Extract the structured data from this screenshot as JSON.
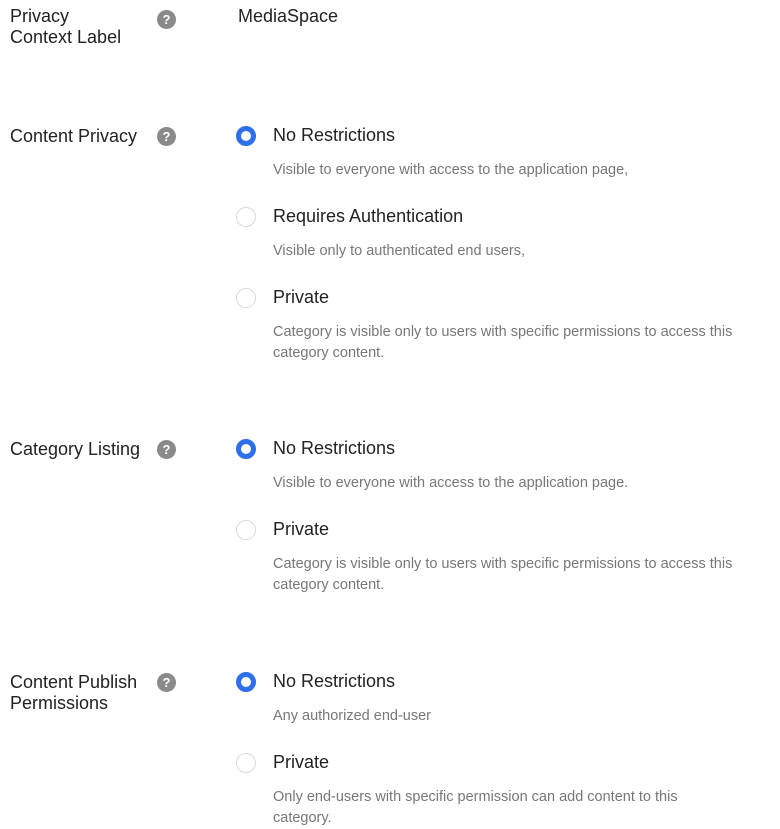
{
  "privacy_context": {
    "label": "Privacy Context Label",
    "value": "MediaSpace",
    "help_icon": "?"
  },
  "content_privacy": {
    "label": "Content Privacy",
    "help_icon": "?",
    "options": [
      {
        "label": "No Restrictions",
        "description": "Visible to everyone with access to the application page,",
        "checked": true
      },
      {
        "label": "Requires Authentication",
        "description": "Visible only to authenticated end users,",
        "checked": false
      },
      {
        "label": "Private",
        "description": "Category is visible only to users with specific permissions to access this category content.",
        "checked": false
      }
    ]
  },
  "category_listing": {
    "label": "Category Listing",
    "help_icon": "?",
    "options": [
      {
        "label": "No Restrictions",
        "description": "Visible to everyone with access to the application page.",
        "checked": true
      },
      {
        "label": "Private",
        "description": "Category is visible only to users with specific permissions to access this category content.",
        "checked": false
      }
    ]
  },
  "content_publish": {
    "label": "Content Publish Permissions",
    "help_icon": "?",
    "options": [
      {
        "label": "No Restrictions",
        "description": "Any authorized end-user",
        "checked": true
      },
      {
        "label": "Private",
        "description": "Only end-users with specific permission can add content to this category.",
        "checked": false
      }
    ]
  },
  "colors": {
    "radio_selected": "#2f6fea",
    "help_icon_bg": "#8a8a8a",
    "description_text": "#777777"
  }
}
